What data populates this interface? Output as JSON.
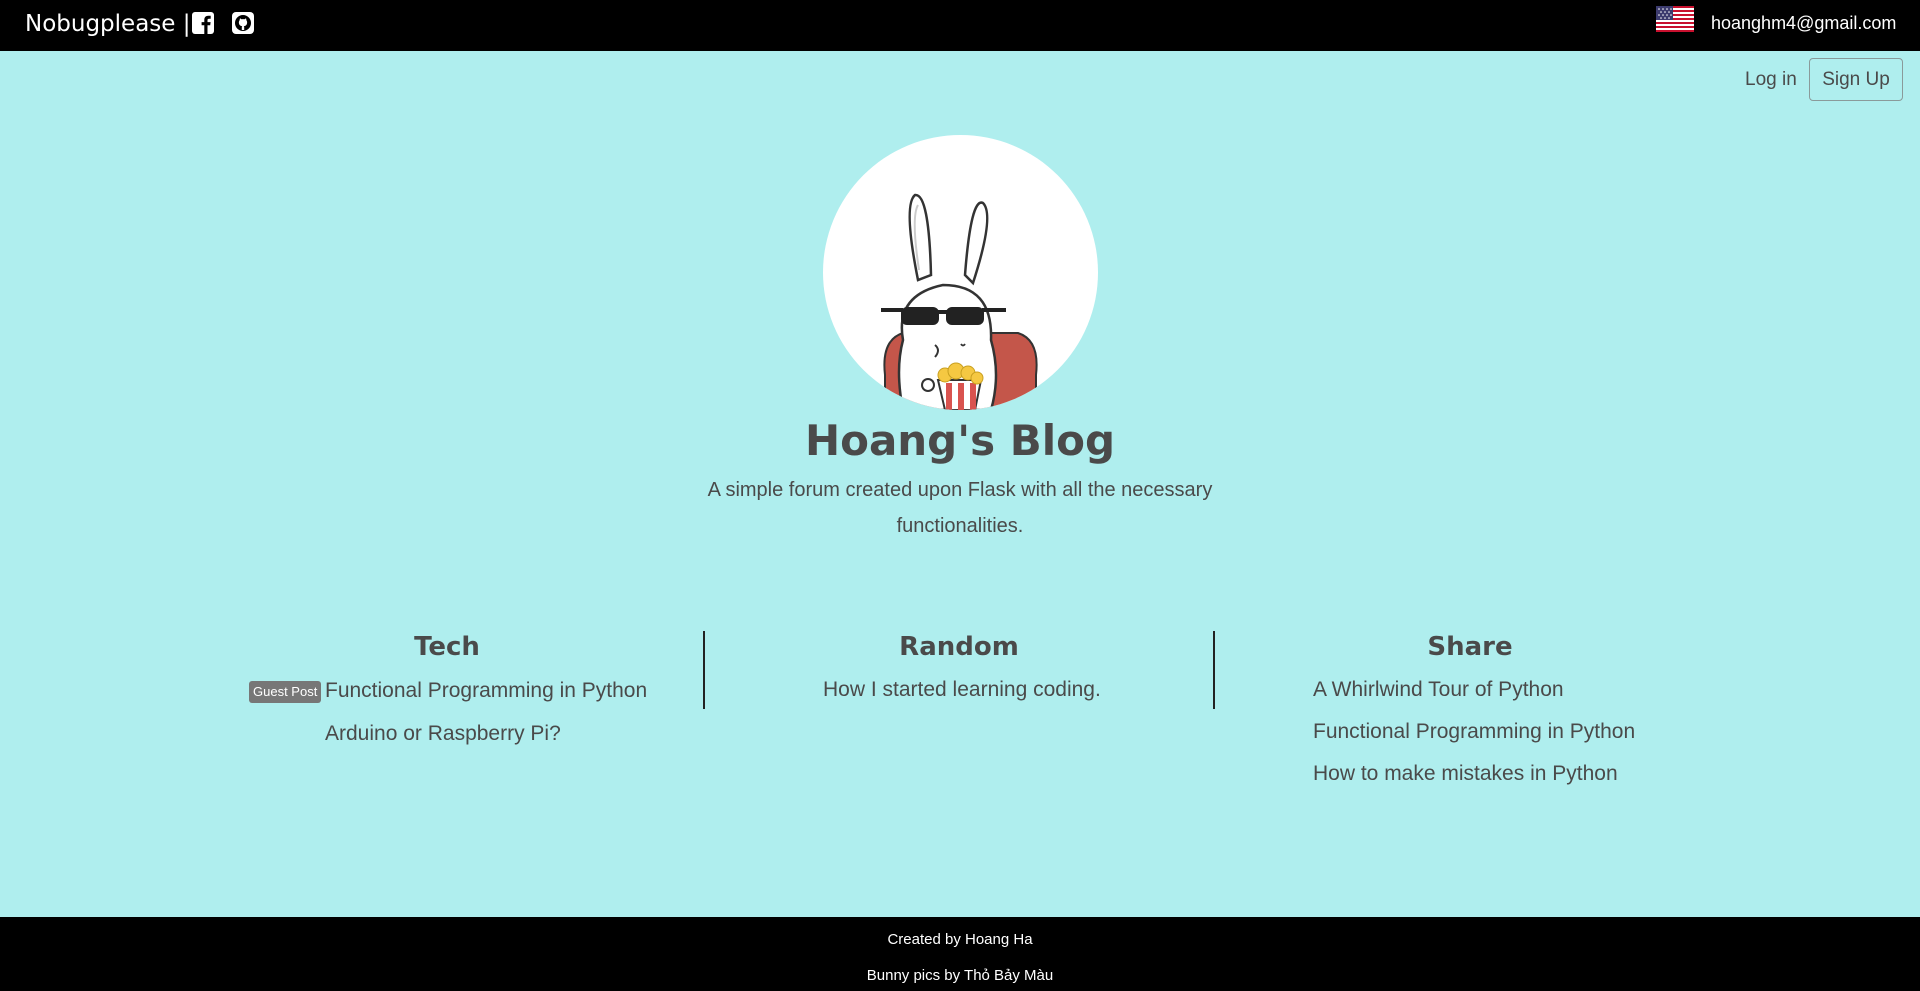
{
  "topbar": {
    "brand": "Nobugplease |",
    "email": "hoanghm4@gmail.com"
  },
  "auth": {
    "login": "Log in",
    "signup": "Sign Up"
  },
  "hero": {
    "title": "Hoang's Blog",
    "subtitle": "A simple forum created upon Flask with all the necessary functionalities."
  },
  "columns": {
    "tech": {
      "title": "Tech",
      "badge": "Guest Post",
      "posts": [
        "Functional Programming in Python",
        "Arduino or Raspberry Pi?"
      ]
    },
    "random": {
      "title": "Random",
      "posts": [
        "How I started learning coding."
      ]
    },
    "share": {
      "title": "Share",
      "posts": [
        "A Whirlwind Tour of Python",
        "Functional Programming in Python",
        "How to make mistakes in Python"
      ]
    }
  },
  "footer": {
    "created": "Created by Hoang Ha",
    "credit": "Bunny pics by Thỏ Bảy Màu"
  },
  "icons": [
    "facebook-icon",
    "github-icon",
    "us-flag-icon"
  ],
  "colors": {
    "background": "#afeeee",
    "bar": "#000000",
    "text": "#4a4a4a"
  }
}
